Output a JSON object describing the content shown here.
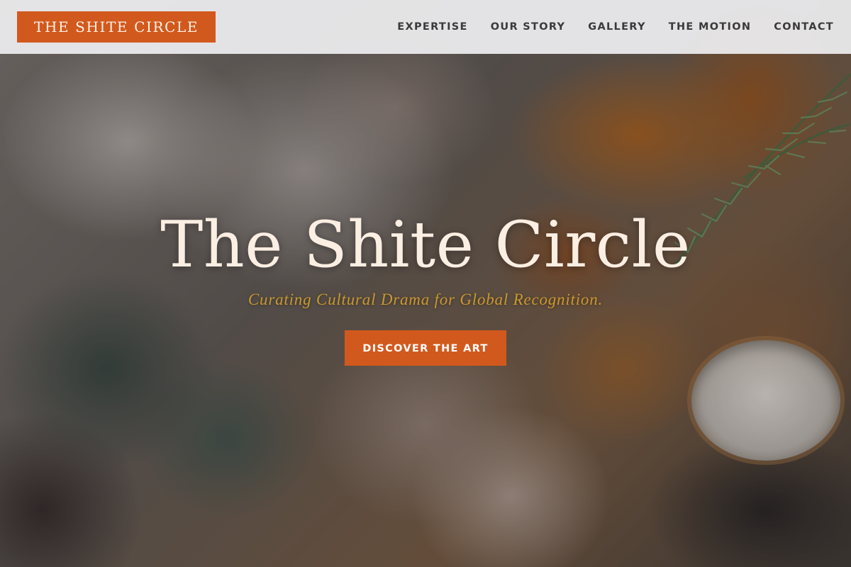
{
  "brand": {
    "logo_text": "THE SHITE CIRCLE",
    "accent_color": "#d2591d"
  },
  "nav": {
    "items": [
      {
        "label": "EXPERTISE"
      },
      {
        "label": "OUR STORY"
      },
      {
        "label": "GALLERY"
      },
      {
        "label": "THE MOTION"
      },
      {
        "label": "CONTACT"
      }
    ]
  },
  "hero": {
    "title": "The Shite Circle",
    "tagline": "Curating Cultural Drama for Global Recognition.",
    "cta_label": "DISCOVER THE ART",
    "tagline_color": "#c9982e",
    "title_color": "#fbeee2"
  }
}
